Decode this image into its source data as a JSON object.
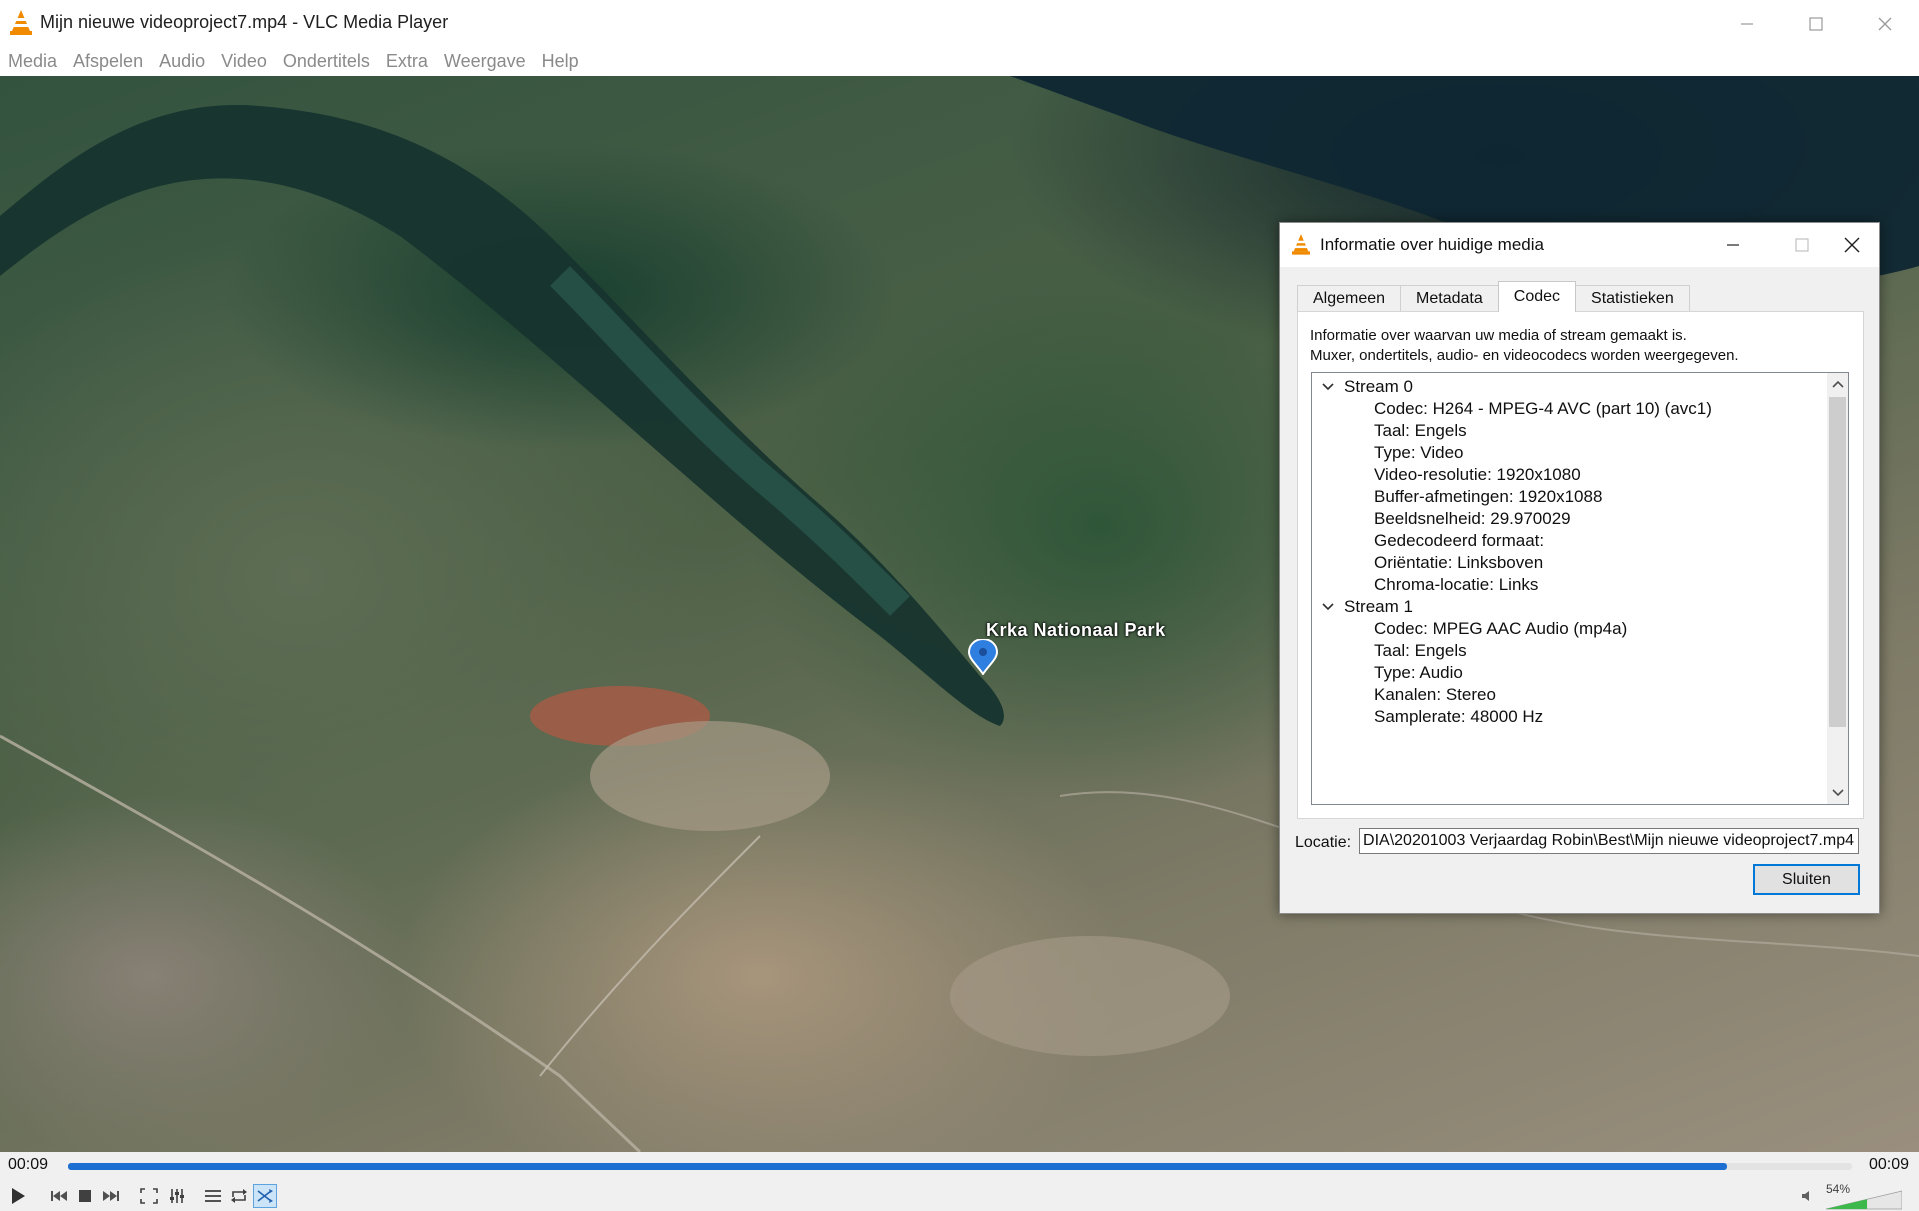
{
  "window": {
    "title": "Mijn nieuwe videoproject7.mp4 - VLC Media Player"
  },
  "menu": [
    "Media",
    "Afspelen",
    "Audio",
    "Video",
    "Ondertitels",
    "Extra",
    "Weergave",
    "Help"
  ],
  "video": {
    "map_label": "Krka Nationaal Park"
  },
  "dialog": {
    "title": "Informatie over huidige media",
    "tabs": [
      "Algemeen",
      "Metadata",
      "Codec",
      "Statistieken"
    ],
    "active_tab": "Codec",
    "description_line1": "Informatie over waarvan uw media of stream gemaakt is.",
    "description_line2": "Muxer, ondertitels, audio- en videocodecs worden weergegeven.",
    "streams": [
      {
        "name": "Stream 0",
        "items": [
          "Codec: H264 - MPEG-4 AVC (part 10) (avc1)",
          "Taal: Engels",
          "Type: Video",
          "Video-resolutie: 1920x1080",
          "Buffer-afmetingen: 1920x1088",
          "Beeldsnelheid: 29.970029",
          "Gedecodeerd formaat:",
          "Oriëntatie: Linksboven",
          "Chroma-locatie: Links"
        ]
      },
      {
        "name": "Stream 1",
        "items": [
          "Codec: MPEG AAC Audio (mp4a)",
          "Taal: Engels",
          "Type: Audio",
          "Kanalen: Stereo",
          "Samplerate: 48000 Hz"
        ]
      }
    ],
    "location_label": "Locatie:",
    "location_value": "DIA\\20201003 Verjaardag Robin\\Best\\Mijn nieuwe videoproject7.mp4",
    "close_label": "Sluiten"
  },
  "player": {
    "elapsed": "00:09",
    "total": "00:09",
    "progress_fraction": 0.93,
    "volume": "54%",
    "volume_fraction": 0.54
  },
  "colors": {
    "accent": "#1e6fd2",
    "focus_border": "#0078d7"
  }
}
